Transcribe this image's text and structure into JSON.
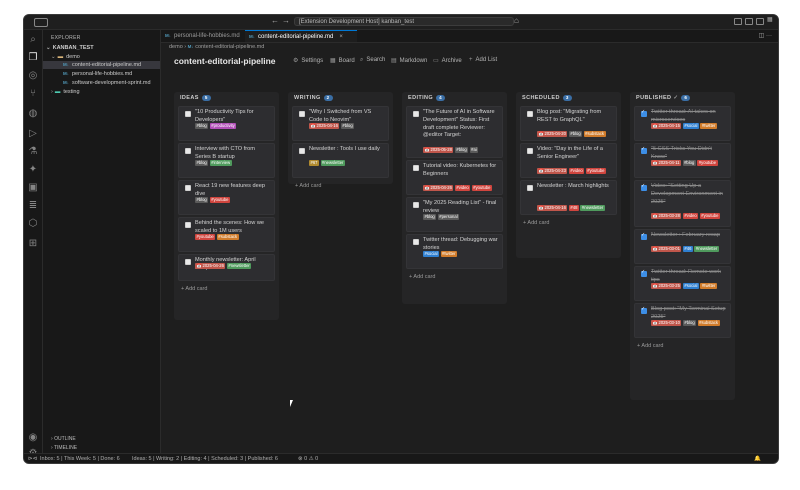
{
  "titlebar": {
    "command_center": "[Extension Development Host] kanban_test",
    "back_icon": "arrow-left-icon",
    "forward_icon": "arrow-right-icon"
  },
  "sidebar": {
    "title": "EXPLORER",
    "root": "KANBAN_TEST",
    "items": [
      {
        "label": "demo",
        "kind": "folder"
      },
      {
        "label": "content-editorial-pipeline.md",
        "kind": "md",
        "badge": "M↓"
      },
      {
        "label": "personal-life-hobbies.md",
        "kind": "md",
        "badge": "M↓"
      },
      {
        "label": "software-development-sprint.md",
        "kind": "md",
        "badge": "M↓"
      },
      {
        "label": "testing",
        "kind": "folder"
      }
    ],
    "outline": "OUTLINE",
    "timeline": "TIMELINE"
  },
  "tabs": [
    {
      "label": "personal-life-hobbies.md",
      "badge": "M↓"
    },
    {
      "label": "content-editorial-pipeline.md",
      "badge": "M↓",
      "close": "×"
    }
  ],
  "breadcrumb": {
    "folder": "demo",
    "sep": "›",
    "badge": "M↓",
    "file": "content-editorial-pipeline.md"
  },
  "board": {
    "title": "content-editorial-pipeline",
    "toolbar": [
      {
        "label": "Settings",
        "icon": "gear-icon",
        "glyph": "⚙"
      },
      {
        "label": "Board",
        "icon": "board-icon",
        "glyph": "▦"
      },
      {
        "label": "Search",
        "icon": "search-icon",
        "glyph": "⌕"
      },
      {
        "label": "Markdown",
        "icon": "markdown-icon",
        "glyph": "▤"
      },
      {
        "label": "Archive",
        "icon": "archive-icon",
        "glyph": "▭"
      },
      {
        "label": "Add List",
        "icon": "plus-icon",
        "glyph": "+"
      }
    ],
    "add_card": "+ Add card",
    "columns": [
      {
        "name": "IDEAS",
        "count": "5",
        "cards": [
          {
            "title": "\"10 Productivity Tips for Developers\"",
            "done": false,
            "tags": [
              {
                "t": "#blog",
                "c": "#5a5a5a"
              },
              {
                "t": "#productivity",
                "c": "#b24fb8"
              }
            ]
          },
          {
            "title": "Interview with CTO from Series B startup",
            "done": false,
            "tags": [
              {
                "t": "#blog",
                "c": "#5a5a5a"
              },
              {
                "t": "#interview",
                "c": "#4f9a5d"
              }
            ]
          },
          {
            "title": "React 19 new features deep dive",
            "done": false,
            "tags": [
              {
                "t": "#blog",
                "c": "#5a5a5a"
              },
              {
                "t": "#youtube",
                "c": "#d0453e"
              }
            ]
          },
          {
            "title": "Behind the scenes: How we scaled to 1M users",
            "done": false,
            "tags": [
              {
                "t": "#youtube",
                "c": "#d0453e"
              },
              {
                "t": "#substack",
                "c": "#d07b2a"
              }
            ]
          },
          {
            "title": "Monthly newsletter: April recap",
            "done": false,
            "tags": [
              {
                "t": "2025-04-26",
                "c": "date"
              },
              {
                "t": "#newsletter",
                "c": "#4f9a5d"
              }
            ]
          }
        ]
      },
      {
        "name": "WRITING",
        "count": "2",
        "cards": [
          {
            "title": "\"Why I Switched from VS Code to Neovim\"",
            "done": false,
            "tags": [
              {
                "t": "2025-04-16",
                "c": "date"
              },
              {
                "t": "#blog",
                "c": "#5a5a5a"
              }
            ]
          },
          {
            "title": "Newsletter : Tools I use daily",
            "done": false,
            "tags": [
              {
                "t": "#67",
                "c": "#b08a2e"
              },
              {
                "t": "#newsletter",
                "c": "#4f9a5d"
              }
            ]
          }
        ]
      },
      {
        "name": "EDITING",
        "count": "4",
        "cards": [
          {
            "title": "\"The Future of AI in Software Development\" Status: First draft complete Reviewer: @editor Target:",
            "done": false,
            "tags": [
              {
                "t": "2025-05-28",
                "c": "date"
              },
              {
                "t": "#blog",
                "c": "#5a5a5a"
              },
              {
                "t": "#ai",
                "c": "#5a5a5a"
              }
            ]
          },
          {
            "title": "Tutorial video: Kubernetes for Beginners",
            "done": false,
            "tags": [
              {
                "t": "2025-04-26",
                "c": "date"
              },
              {
                "t": "#video",
                "c": "#d0453e"
              },
              {
                "t": "#youtube",
                "c": "#d0453e"
              }
            ]
          },
          {
            "title": "\"My 2025 Reading List\" - final review",
            "done": false,
            "tags": [
              {
                "t": "#blog",
                "c": "#5a5a5a"
              },
              {
                "t": "#personal",
                "c": "#5a5a5a"
              }
            ]
          },
          {
            "title": "Twitter thread: Debugging war stories",
            "done": false,
            "tags": [
              {
                "t": "#social",
                "c": "#2f7fd0"
              },
              {
                "t": "#twitter",
                "c": "#d07b2a"
              }
            ]
          }
        ]
      },
      {
        "name": "SCHEDULED",
        "count": "3",
        "cards": [
          {
            "title": "Blog post: \"Migrating from REST to GraphQL\"",
            "done": false,
            "tags": [
              {
                "t": "2025-04-20",
                "c": "date"
              },
              {
                "t": "#blog",
                "c": "#5a5a5a"
              },
              {
                "t": "#substack",
                "c": "#d07b2a"
              }
            ]
          },
          {
            "title": "Video: \"Day in the Life of a Senior Engineer\"",
            "done": false,
            "tags": [
              {
                "t": "2025-04-23",
                "c": "date"
              },
              {
                "t": "#video",
                "c": "#d0453e"
              },
              {
                "t": "#youtube",
                "c": "#d0453e"
              }
            ]
          },
          {
            "title": "Newsletter : March highlights",
            "done": false,
            "tags": [
              {
                "t": "2025-04-16",
                "c": "date"
              },
              {
                "t": "#48",
                "c": "#d0453e"
              },
              {
                "t": "#newsletter",
                "c": "#4f9a5d"
              }
            ]
          }
        ]
      },
      {
        "name": "PUBLISHED",
        "count": "6",
        "check": "✓",
        "cards": [
          {
            "title": "Twitter thread: AI takes on microservices",
            "done": true,
            "tags": [
              {
                "t": "2025-04-15",
                "c": "date"
              },
              {
                "t": "#social",
                "c": "#2f7fd0"
              },
              {
                "t": "#twitter",
                "c": "#d07b2a"
              }
            ]
          },
          {
            "title": "\"5 CSS Tricks You Didn't Know\"",
            "done": true,
            "tags": [
              {
                "t": "2025-04-11",
                "c": "date"
              },
              {
                "t": "#blog",
                "c": "#5a5a5a"
              },
              {
                "t": "#youtube",
                "c": "#d0453e"
              }
            ]
          },
          {
            "title": "Video: \"Setting Up a Development Environment in 2025\"",
            "done": true,
            "tags": [
              {
                "t": "2025-03-28",
                "c": "date"
              },
              {
                "t": "#video",
                "c": "#d0453e"
              },
              {
                "t": "#youtube",
                "c": "#d0453e"
              }
            ]
          },
          {
            "title": "Newsletter : February recap",
            "done": true,
            "tags": [
              {
                "t": "2025-03-01",
                "c": "date"
              },
              {
                "t": "#46",
                "c": "#2f7fd0"
              },
              {
                "t": "#newsletter",
                "c": "#4f9a5d"
              }
            ]
          },
          {
            "title": "Twitter thread: Remote work tips",
            "done": true,
            "tags": [
              {
                "t": "2025-03-25",
                "c": "date"
              },
              {
                "t": "#social",
                "c": "#2f7fd0"
              },
              {
                "t": "#twitter",
                "c": "#d07b2a"
              }
            ]
          },
          {
            "title": "Blog post: \"My Terminal Setup 2025\"",
            "done": true,
            "tags": [
              {
                "t": "2025-03-10",
                "c": "date"
              },
              {
                "t": "#blog",
                "c": "#5a5a5a"
              },
              {
                "t": "#substack",
                "c": "#d07b2a"
              }
            ]
          }
        ]
      }
    ]
  },
  "status": {
    "left": "Inbox: 5 | This Week: 5 | Done: 6",
    "middle": "Ideas: 5 | Writing: 2 | Editing: 4 | Scheduled: 3 | Published: 6",
    "problems": "⊗ 0 ⚠ 0"
  }
}
